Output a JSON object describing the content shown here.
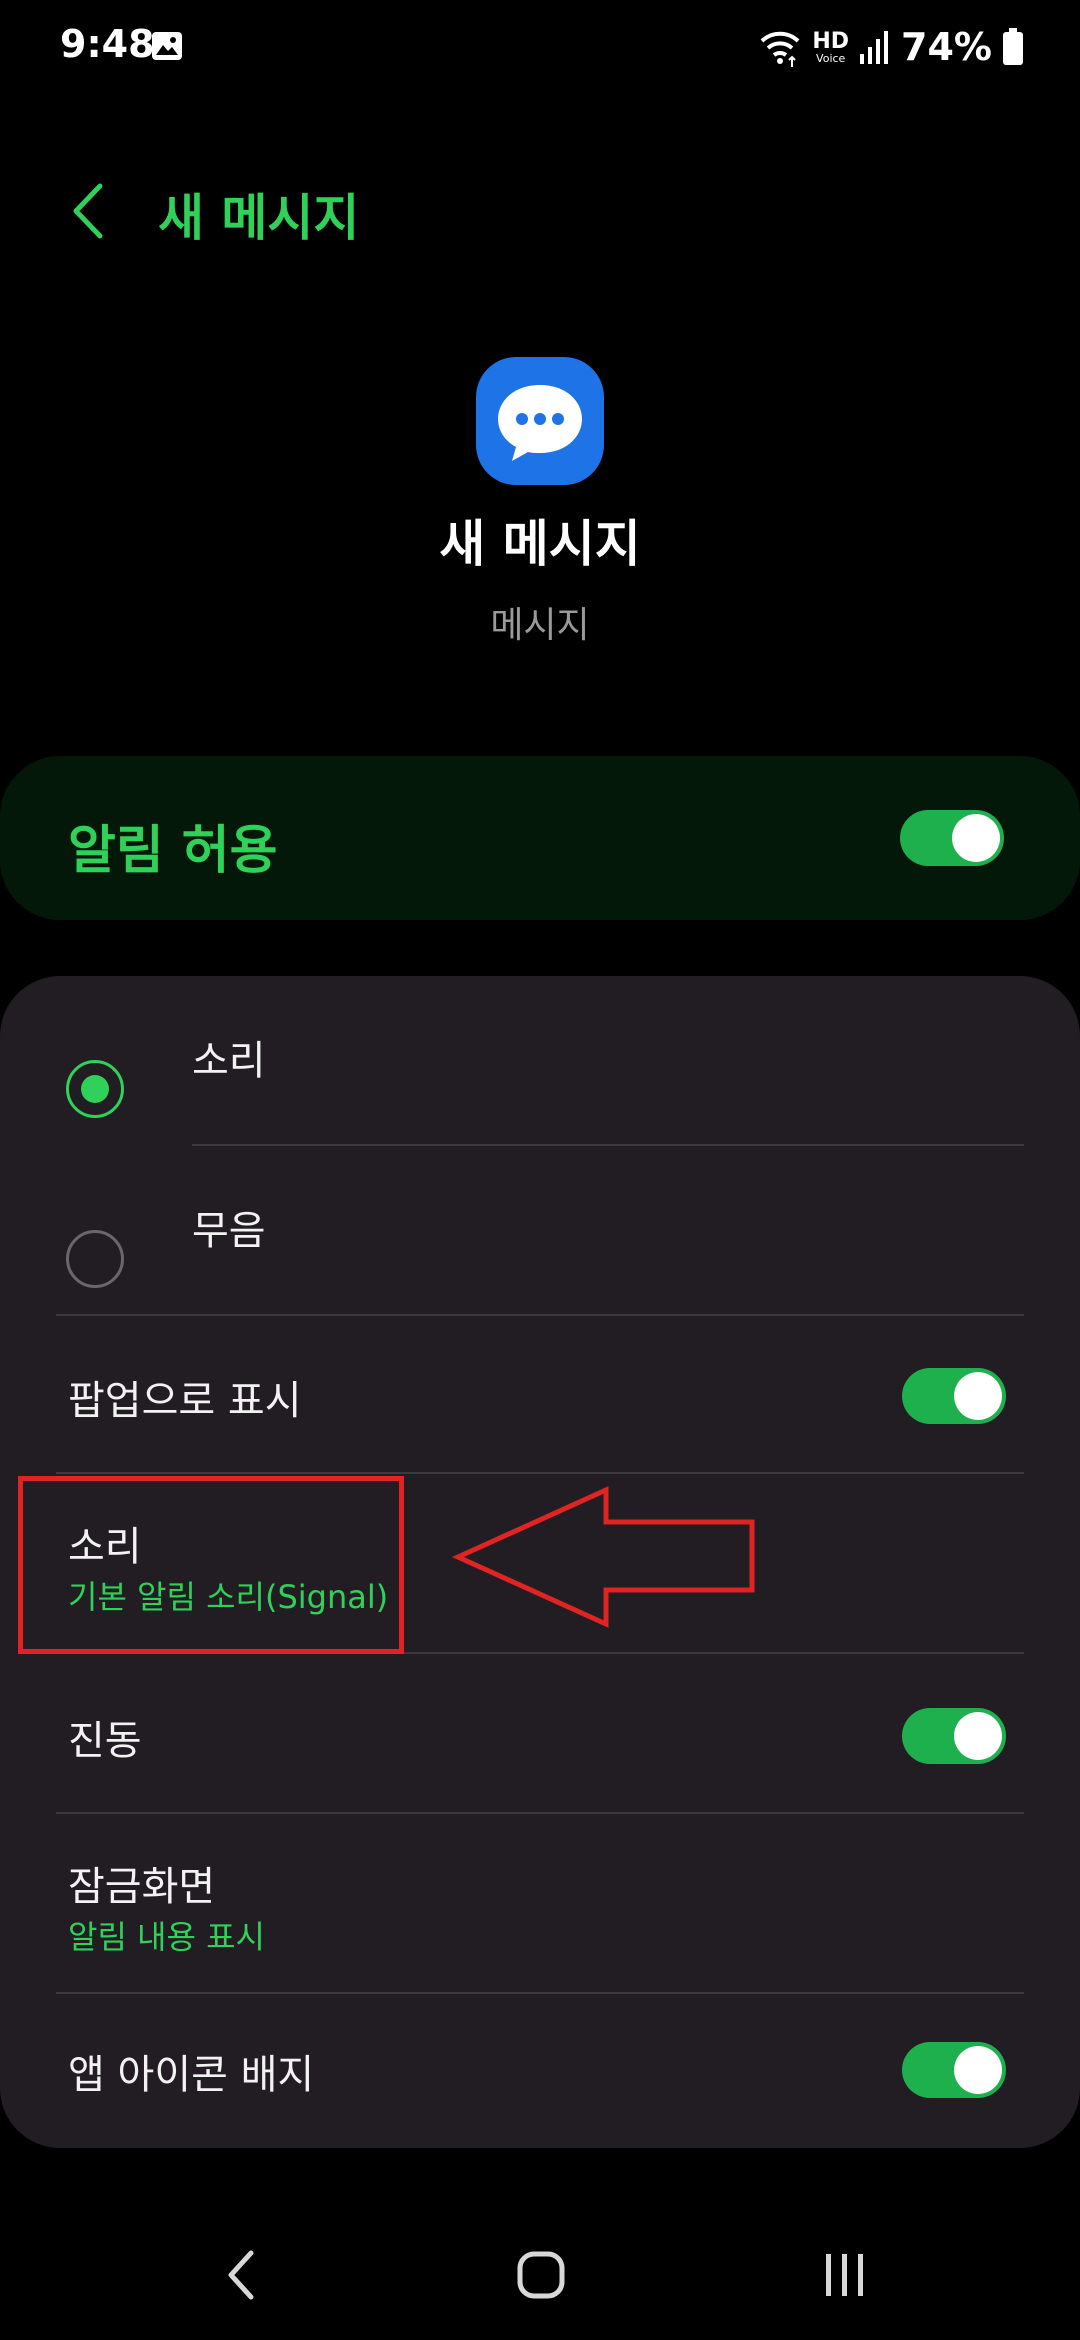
{
  "status_bar": {
    "time": "9:48",
    "network_label": "HD",
    "network_sub": "Voice",
    "battery_percent": "74%"
  },
  "header": {
    "title": "새 메시지"
  },
  "app": {
    "name": "새 메시지",
    "subtitle": "메시지",
    "icon_color": "#1e73e6"
  },
  "allow_notifications": {
    "label": "알림 허용",
    "enabled": true
  },
  "sound_mode": {
    "options": [
      {
        "label": "소리",
        "selected": true
      },
      {
        "label": "무음",
        "selected": false
      }
    ]
  },
  "settings": {
    "popup": {
      "label": "팝업으로 표시",
      "enabled": true
    },
    "sound": {
      "label": "소리",
      "value": "기본 알림 소리(Signal)"
    },
    "vibration": {
      "label": "진동",
      "enabled": true
    },
    "lock_screen": {
      "label": "잠금화면",
      "value": "알림 내용 표시"
    },
    "app_icon_badge": {
      "label": "앱 아이콘 배지",
      "enabled": true
    }
  },
  "colors": {
    "accent": "#2fd158",
    "toggle_on": "#1fb04e",
    "annotation": "#e02424"
  }
}
